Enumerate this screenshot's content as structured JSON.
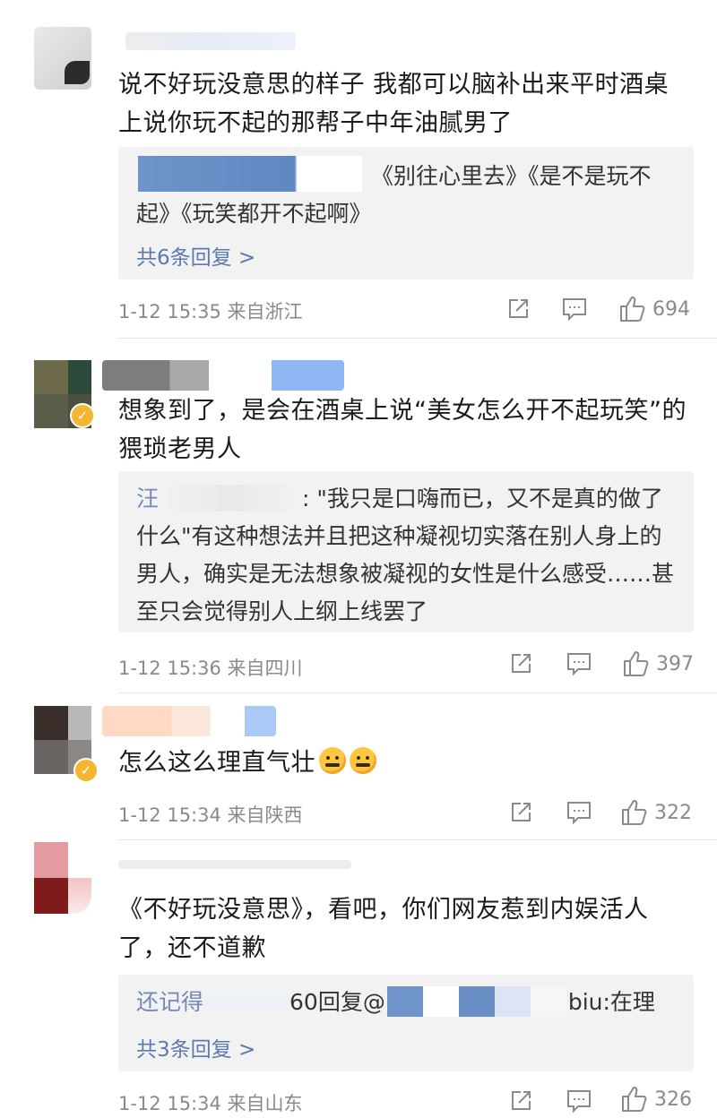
{
  "comments": [
    {
      "text": "说不好玩没意思的样子 我都可以脑补出来平时酒桌上说你玩不起的那帮子中年油腻男了",
      "reply": {
        "user": "",
        "text": "《别往心里去》《是不是玩不起》《玩笑都开不起啊》"
      },
      "reply_more": "共6条回复 >",
      "meta": "1-12 15:35  来自浙江",
      "likes": "694"
    },
    {
      "text": "想象到了，是会在酒桌上说“美女怎么开不起玩笑”的猥琐老男人",
      "reply": {
        "user": "汪",
        "text": "\"我只是口嗨而已，又不是真的做了什么\"有这种想法并且把这种凝视切实落在别人身上的男人，确实是无法想象被凝视的女性是什么感受……甚至只会觉得别人上纲上线罢了"
      },
      "meta": "1-12 15:36  来自四川",
      "likes": "397"
    },
    {
      "text": "怎么这么理直气壮",
      "meta": "1-12 15:34  来自陕西",
      "likes": "322"
    },
    {
      "text": "《不好玩没意思》，看吧，你们网友惹到内娱活人了，还不道歉",
      "reply": {
        "user": "还记得",
        "text": "60回复@",
        "tail": "biu:在理"
      },
      "reply_more": "共3条回复 >",
      "meta": "1-12 15:34  来自山东",
      "likes": "326"
    }
  ],
  "icons": [
    "share-icon",
    "comment-icon",
    "like-icon",
    "verified-badge-icon",
    "zipper-mouth-emoji-icon"
  ],
  "colors": {
    "link": "#5c79b0",
    "meta": "#8a8a8a",
    "reply_bg": "#f2f2f2",
    "badge": "#f2b630"
  }
}
